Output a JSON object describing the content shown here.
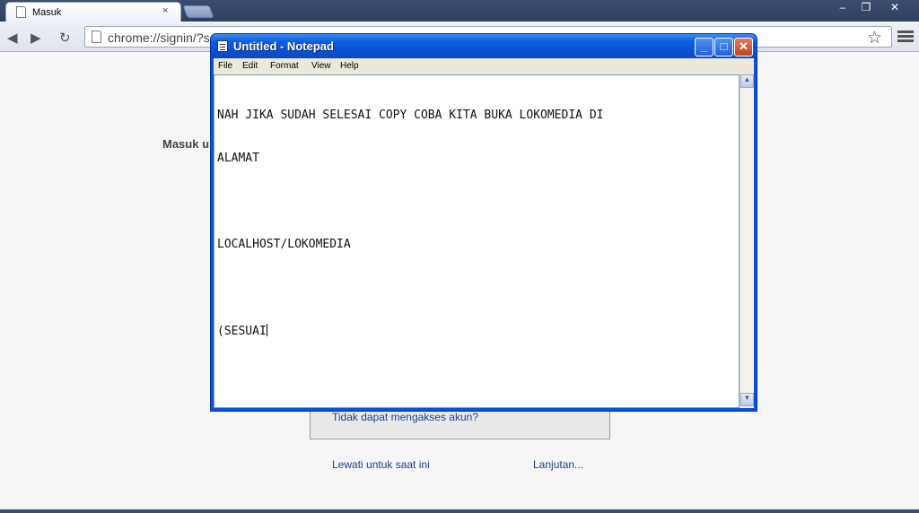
{
  "chrome": {
    "tab_title": "Masuk",
    "tab_close": "×",
    "url": "chrome://signin/?s",
    "window_controls": {
      "minimize": "–",
      "maximize": "❐",
      "close": "✕"
    },
    "nav": {
      "back": "◀",
      "forward": "▶",
      "reload": "↻"
    },
    "bookmark": "☆"
  },
  "page": {
    "heading": "Masuk u",
    "cant_access": "Tidak dapat mengakses akun?",
    "skip": "Lewati untuk saat ini",
    "advanced": "Lanjutan..."
  },
  "notepad": {
    "title": "Untitled - Notepad",
    "buttons": {
      "minimize": "_",
      "maximize": "□",
      "close": "✕"
    },
    "menu": [
      "File",
      "Edit",
      "Format",
      "View",
      "Help"
    ],
    "lines": [
      "NAH JIKA SUDAH SELESAI COPY COBA KITA BUKA LOKOMEDIA DI",
      "ALAMAT",
      "",
      "LOCALHOST/LOKOMEDIA",
      "",
      "(SESUAI"
    ]
  },
  "colors": {
    "xp_title_blue": "#0b4fd3",
    "link_blue": "#1c3f94",
    "chrome_frame": "#3b4d70"
  }
}
